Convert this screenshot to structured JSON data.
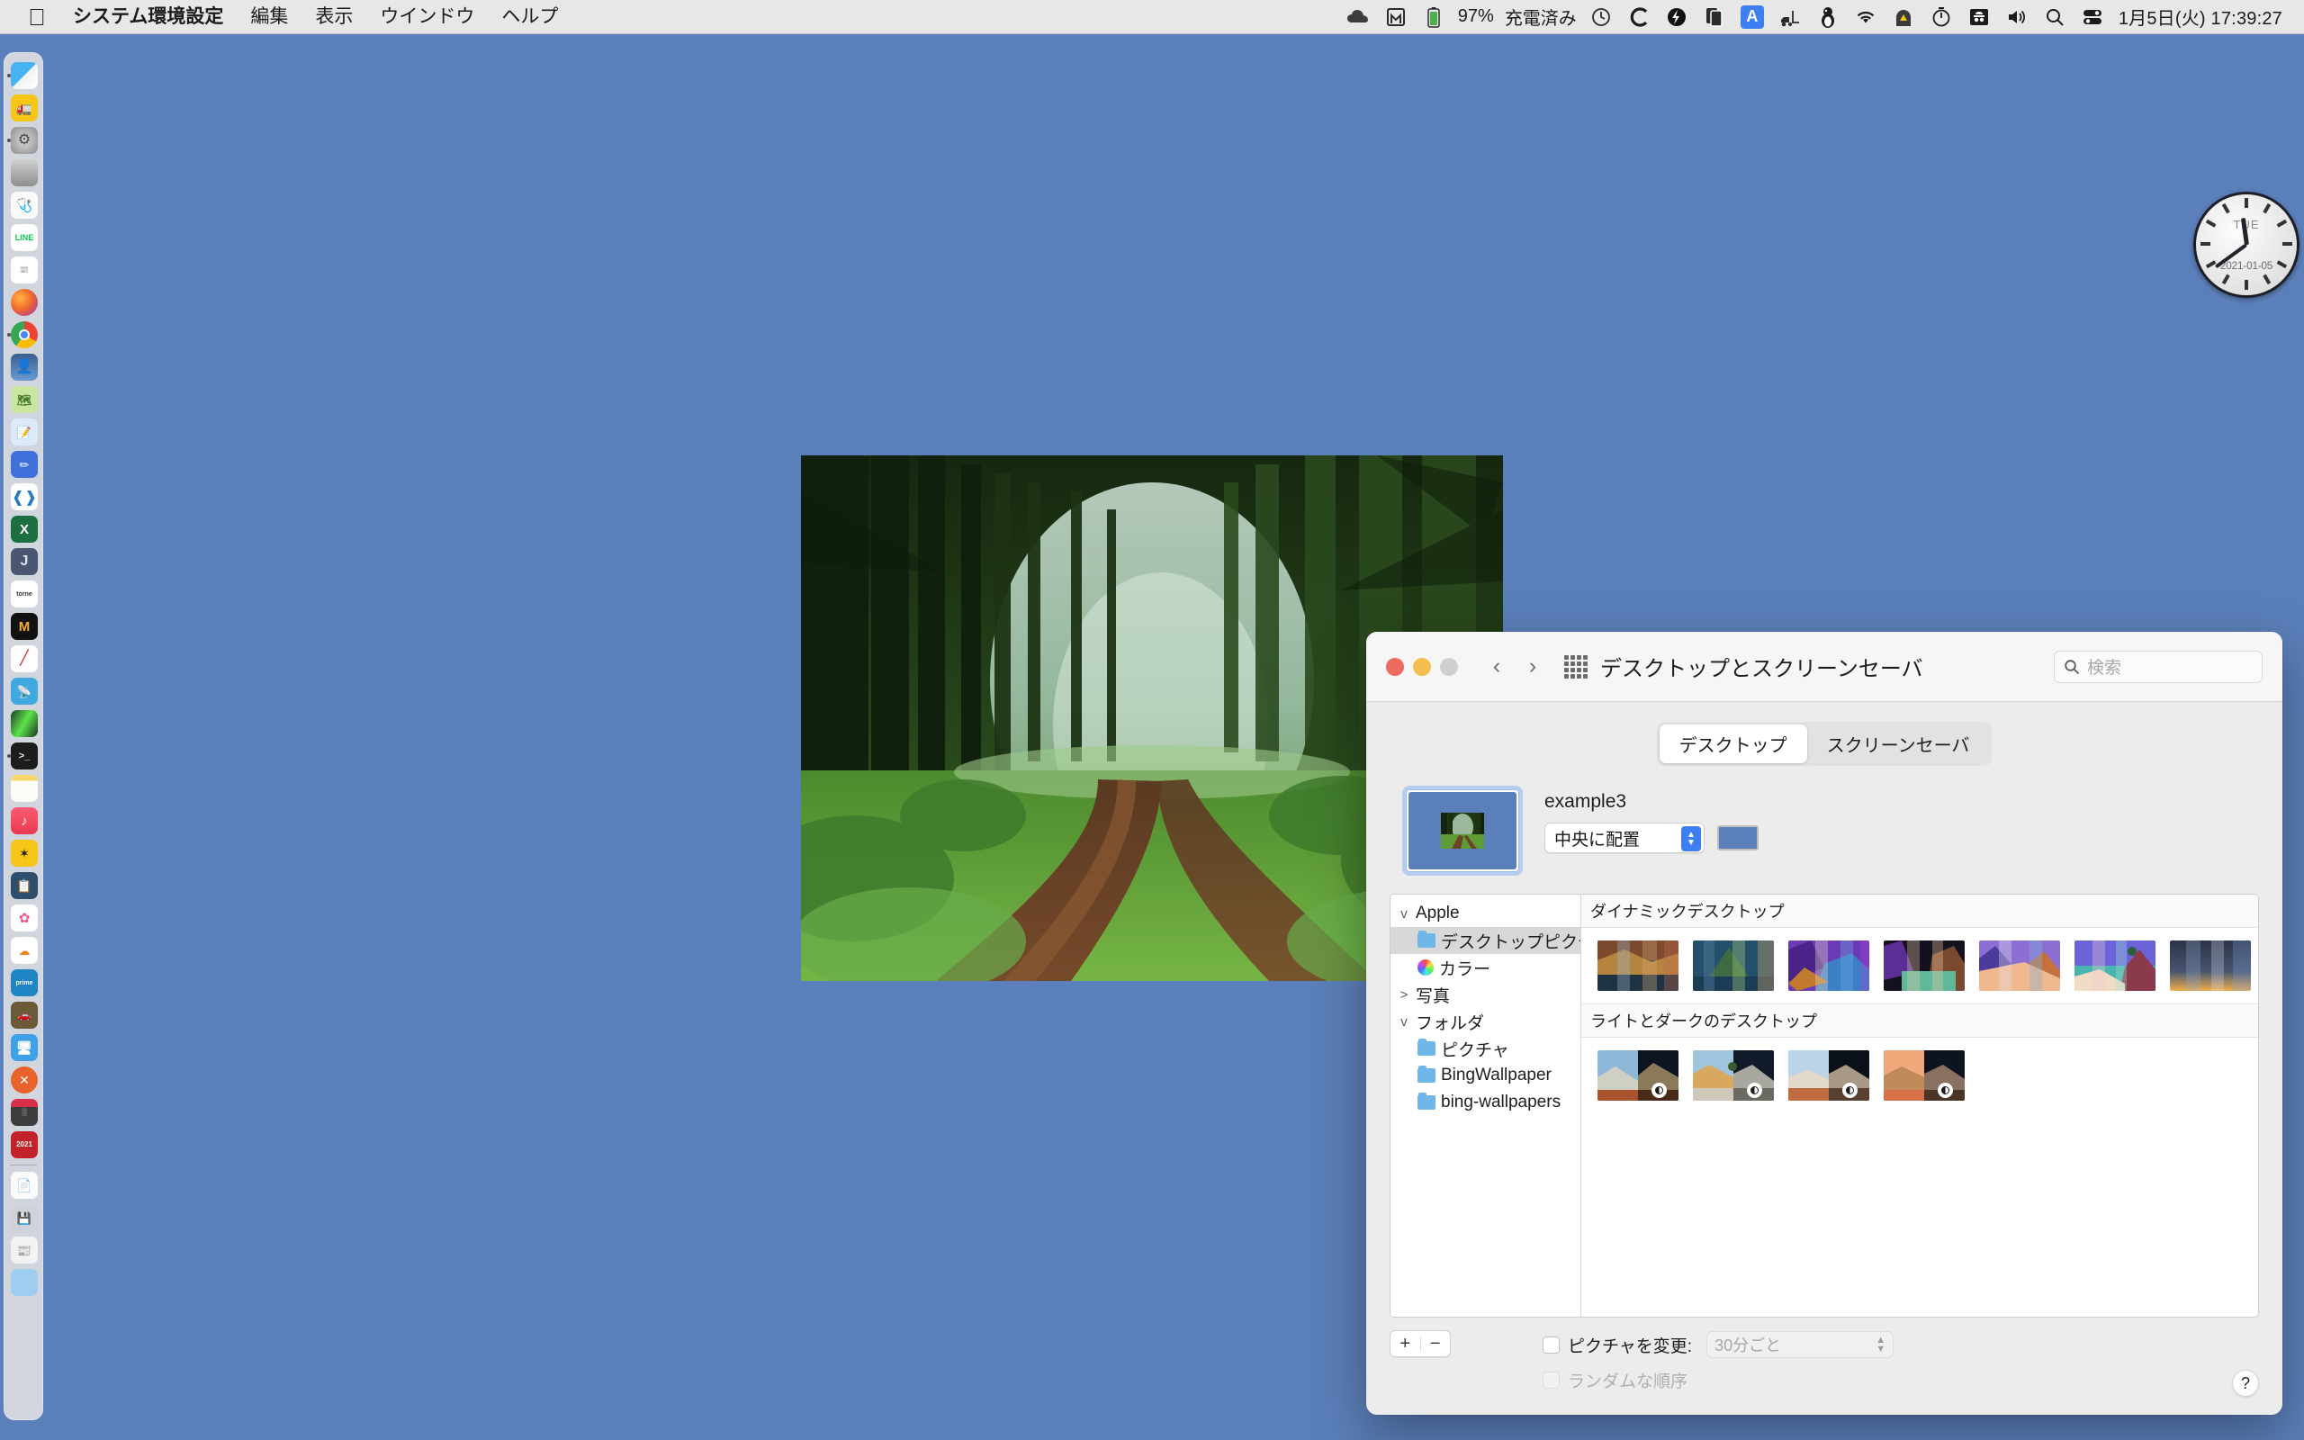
{
  "menubar": {
    "apple_icon": "apple-logo",
    "items": [
      {
        "label": "システム環境設定",
        "bold": true
      },
      {
        "label": "編集",
        "bold": false
      },
      {
        "label": "表示",
        "bold": false
      },
      {
        "label": "ウインドウ",
        "bold": false
      },
      {
        "label": "ヘルプ",
        "bold": false
      }
    ],
    "status": {
      "battery_percent": "97%",
      "battery_state": "充電済み",
      "input_source": "A",
      "datetime": "1月5日(火) 17:39:27"
    }
  },
  "clock_widget": {
    "weekday": "TUE",
    "date": "2021-01-05"
  },
  "window": {
    "title": "デスクトップとスクリーンセーバ",
    "search_placeholder": "検索",
    "tabs": [
      {
        "label": "デスクトップ",
        "active": true
      },
      {
        "label": "スクリーンセーバ",
        "active": false
      }
    ],
    "preview": {
      "wallpaper_name": "example3",
      "fit_mode": "中央に配置",
      "background_color": "#5b7fba"
    },
    "sidebar": [
      {
        "label": "Apple",
        "type": "group",
        "expanded": true,
        "chevron": "v"
      },
      {
        "label": "デスクトップピクチャ",
        "type": "folder",
        "selected": true
      },
      {
        "label": "カラー",
        "type": "color"
      },
      {
        "label": "写真",
        "type": "group",
        "expanded": false,
        "chevron": ">"
      },
      {
        "label": "フォルダ",
        "type": "group",
        "expanded": true,
        "chevron": "v"
      },
      {
        "label": "ピクチャ",
        "type": "folder"
      },
      {
        "label": "BingWallpaper",
        "type": "folder"
      },
      {
        "label": "bing-wallpapers",
        "type": "folder"
      }
    ],
    "gallery": {
      "sections": [
        {
          "title": "ダイナミックデスクトップ",
          "thumbs": [
            {
              "name": "big-sur-dynamic"
            },
            {
              "name": "catalina-dynamic"
            },
            {
              "name": "big-sur-graphic-purple"
            },
            {
              "name": "big-sur-graphic-teal"
            },
            {
              "name": "big-sur-graphic-dunes"
            },
            {
              "name": "big-sur-graphic-shore"
            },
            {
              "name": "solar-gradients"
            }
          ]
        },
        {
          "title": "ライトとダークのデスクトップ",
          "thumbs": [
            {
              "name": "white-sands-1",
              "badge": true
            },
            {
              "name": "white-sands-2",
              "badge": true
            },
            {
              "name": "white-sands-3",
              "badge": true
            },
            {
              "name": "white-sands-4",
              "badge": true
            }
          ]
        }
      ]
    },
    "bottom": {
      "add_label": "+",
      "remove_label": "−",
      "change_picture_label": "ピクチャを変更:",
      "change_picture_checked": false,
      "interval_value": "30分ごと",
      "random_order_label": "ランダムな順序",
      "random_order_checked": false,
      "help_label": "?"
    }
  },
  "dock": {
    "items": [
      {
        "name": "finder",
        "running": true
      },
      {
        "name": "forklift",
        "running": false
      },
      {
        "name": "settings-gear",
        "running": true
      },
      {
        "name": "tunnelbear",
        "running": false
      },
      {
        "name": "stethoscope",
        "running": false
      },
      {
        "name": "line",
        "running": false
      },
      {
        "name": "yahoo-news",
        "running": false
      },
      {
        "name": "firefox",
        "running": false
      },
      {
        "name": "chrome",
        "running": true
      },
      {
        "name": "reader",
        "running": false
      },
      {
        "name": "maps-notes",
        "running": false
      },
      {
        "name": "notes-pen",
        "running": false
      },
      {
        "name": "paint-pencil",
        "running": false
      },
      {
        "name": "vscode",
        "running": false
      },
      {
        "name": "excel",
        "running": false
      },
      {
        "name": "jdownloader",
        "running": false
      },
      {
        "name": "torne",
        "running": false
      },
      {
        "name": "m-app",
        "running": false
      },
      {
        "name": "niconico",
        "running": false
      },
      {
        "name": "radio",
        "running": false
      },
      {
        "name": "aurora",
        "running": false
      },
      {
        "name": "terminal",
        "running": true
      },
      {
        "name": "notes",
        "running": false
      },
      {
        "name": "music",
        "running": false
      },
      {
        "name": "mathematica",
        "running": false
      },
      {
        "name": "clipboard",
        "running": false
      },
      {
        "name": "photos",
        "running": false
      },
      {
        "name": "yahoo-weather",
        "running": false
      },
      {
        "name": "prime-video",
        "running": false
      },
      {
        "name": "garage",
        "running": false
      },
      {
        "name": "classic-mac",
        "running": false
      },
      {
        "name": "remote-desktop",
        "running": false
      },
      {
        "name": "parallels",
        "running": false
      },
      {
        "name": "hagaki-2021",
        "running": false
      },
      {
        "name": "separator",
        "running": false
      },
      {
        "name": "document",
        "running": false
      },
      {
        "name": "disk-image",
        "running": false
      },
      {
        "name": "news-doc",
        "running": false
      },
      {
        "name": "blue-doc",
        "running": false
      }
    ]
  }
}
